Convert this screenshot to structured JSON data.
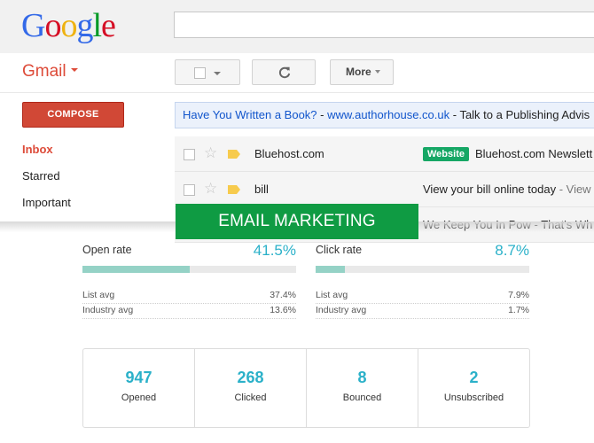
{
  "header": {
    "logo": [
      "G",
      "o",
      "o",
      "g",
      "l",
      "e"
    ],
    "logo_colors": [
      "#3369e8",
      "#d50f25",
      "#eeb211",
      "#3369e8",
      "#009925",
      "#d50f25"
    ],
    "search_value": ""
  },
  "toolbar": {
    "gmail_label": "Gmail",
    "more_label": "More"
  },
  "sidebar": {
    "compose_label": "COMPOSE",
    "items": [
      {
        "label": "Inbox",
        "active": true
      },
      {
        "label": "Starred",
        "active": false
      },
      {
        "label": "Important",
        "active": false
      }
    ]
  },
  "ad": {
    "title": "Have You Written a Book?",
    "separator": " - ",
    "url": "www.authorhouse.co.uk",
    "text": " - Talk to a Publishing Advis"
  },
  "emails": [
    {
      "sender": "Bluehost.com",
      "label": "Website",
      "subject": "Bluehost.com Newslett",
      "snippet": ""
    },
    {
      "sender": "bill",
      "label": "",
      "subject": "View your bill online today",
      "snippet": " - View"
    },
    {
      "sender": "",
      "label": "",
      "subject": "We Keep You In Pow - That's Wh",
      "snippet": ""
    }
  ],
  "banner": "EMAIL MARKETING",
  "rates": [
    {
      "label": "Open rate",
      "value": "41.5%",
      "fill": 0.5,
      "list_avg_label": "List avg",
      "list_avg": "37.4%",
      "industry_avg_label": "Industry avg",
      "industry_avg": "13.6%"
    },
    {
      "label": "Click rate",
      "value": "8.7%",
      "fill": 0.135,
      "list_avg_label": "List avg",
      "list_avg": "7.9%",
      "industry_avg_label": "Industry avg",
      "industry_avg": "1.7%"
    }
  ],
  "stats": [
    {
      "value": "947",
      "label": "Opened"
    },
    {
      "value": "268",
      "label": "Clicked"
    },
    {
      "value": "8",
      "label": "Bounced"
    },
    {
      "value": "2",
      "label": "Unsubscribed"
    }
  ],
  "colors": {
    "gmail_red": "#dd4b39",
    "compose_red": "#d14836",
    "accent_teal": "#2bb1c9",
    "bar_fill": "#95d2c6",
    "banner_green": "#0f9b43",
    "label_green": "#16a765",
    "tag_yellow": "#f7cb4d"
  },
  "icons": {
    "refresh": "refresh-icon",
    "star": "star-icon",
    "label": "label-tag-icon",
    "checkbox": "checkbox-icon"
  }
}
